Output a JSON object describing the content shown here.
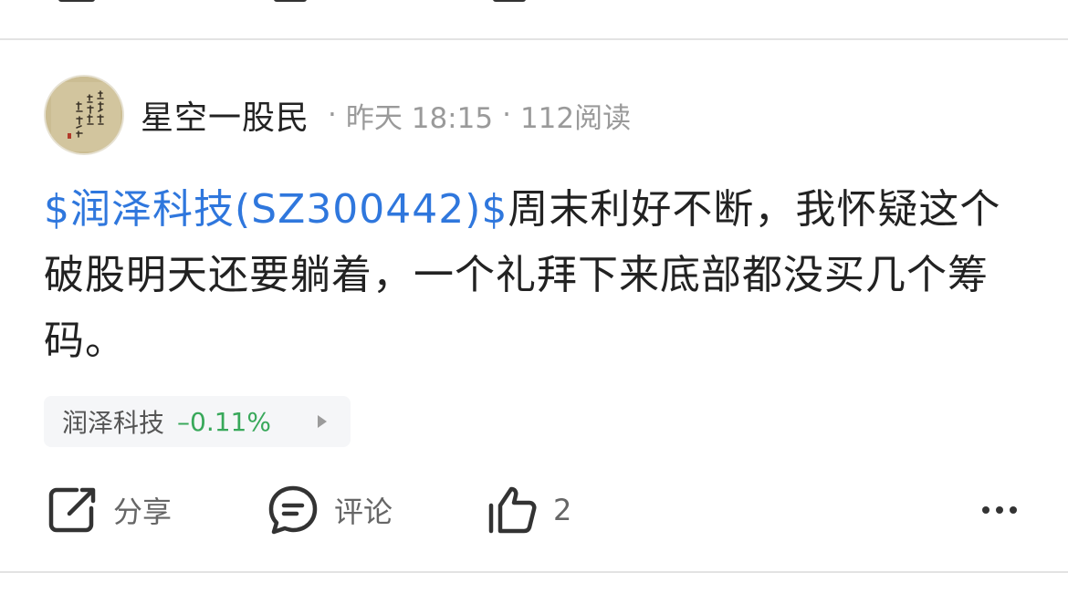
{
  "post": {
    "author": "星空一股民",
    "time": "昨天 18:15",
    "reads": "112阅读",
    "stock_link": "$润泽科技(SZ300442)$",
    "body": "周末利好不断，我怀疑这个破股明天还要躺着，一个礼拜下来底部都没买几个筹码。",
    "stock_chip": {
      "name": "润泽科技",
      "change": "–0.11%",
      "change_color": "#38a85a"
    }
  },
  "actions": {
    "share_label": "分享",
    "comment_label": "评论",
    "like_count": "2"
  },
  "icons": {
    "share": "share-icon",
    "comment": "comment-icon",
    "like": "thumbs-up-icon",
    "more": "more-icon"
  },
  "colors": {
    "link": "#2f77dd",
    "meta": "#9a9a9a",
    "chip_bg": "#f5f6f8"
  }
}
